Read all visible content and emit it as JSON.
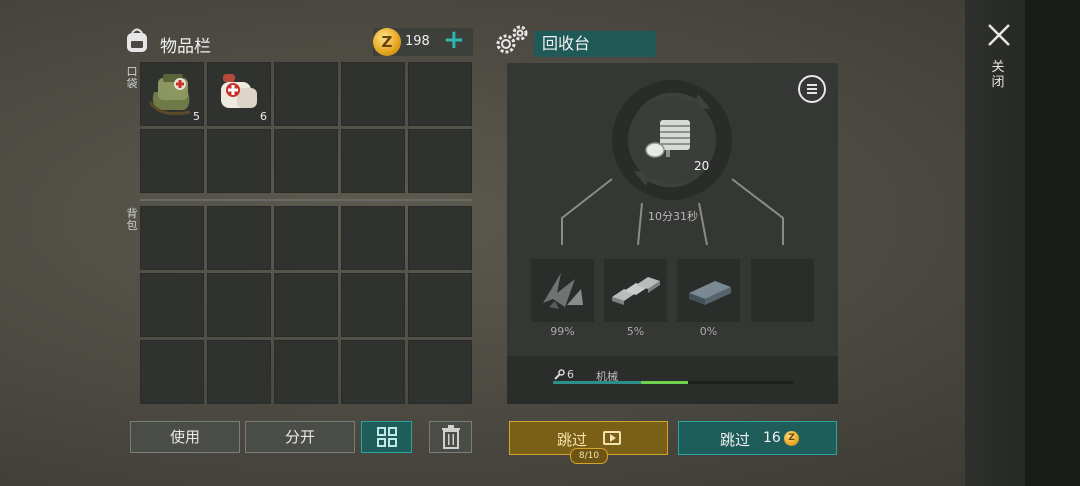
{
  "inventory": {
    "title": "物品栏",
    "coins": "198",
    "coin_symbol": "Z",
    "add_label": "+",
    "pocket_label": "口袋",
    "backpack_label": "背包",
    "pocket_items": [
      {
        "name": "medical-bag",
        "qty": "5"
      },
      {
        "name": "bandage",
        "qty": "6"
      }
    ],
    "buttons": {
      "use": "使用",
      "split": "分开"
    }
  },
  "recycler": {
    "title": "回收台",
    "input_qty": "20",
    "timer": "10分31秒",
    "outputs": [
      {
        "name": "scrap-metal",
        "pct": "99%"
      },
      {
        "name": "metal-bars",
        "pct": "5%"
      },
      {
        "name": "iron-ingot",
        "pct": "0%"
      },
      {
        "name": "empty",
        "pct": ""
      }
    ],
    "skill_level": "6",
    "skill_name": "机械",
    "skip_ad_label": "跳过",
    "ad_count": "8/10",
    "skip_coin_label": "跳过",
    "skip_coin_cost": "16",
    "coin_symbol": "Z"
  },
  "close_label": "关闭",
  "colors": {
    "accent_teal": "#1f5d5a",
    "gold": "#d3a52d",
    "progress_green": "#6cd24e"
  }
}
